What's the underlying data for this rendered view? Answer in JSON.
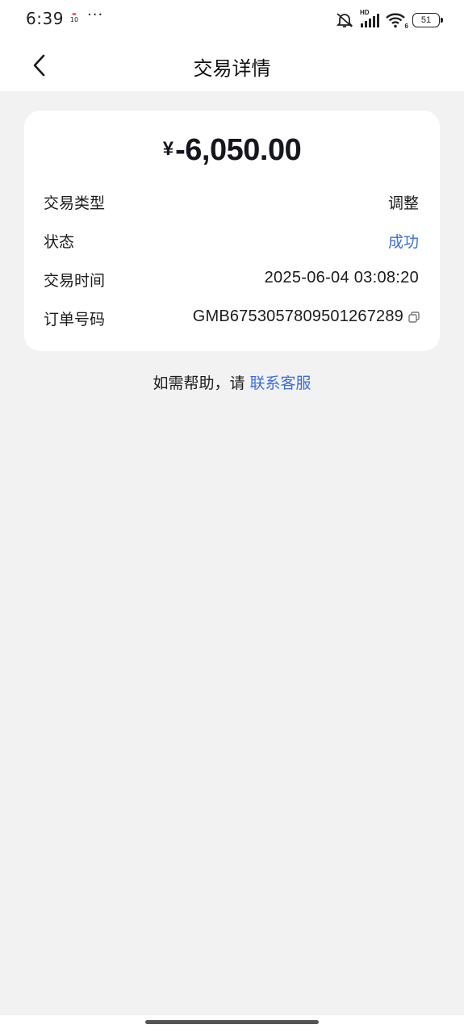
{
  "status_bar": {
    "time": "6:39",
    "calendar_day": "10",
    "more": "···",
    "network_label": "HD",
    "wifi_label": "6",
    "battery": "51"
  },
  "nav": {
    "back_icon": "chevron-left-icon",
    "title": "交易详情"
  },
  "transaction": {
    "currency_symbol": "¥",
    "amount": "-6,050.00",
    "rows": [
      {
        "label": "交易类型",
        "value": "调整"
      },
      {
        "label": "状态",
        "value": "成功"
      },
      {
        "label": "交易时间",
        "value": "2025-06-04 03:08:20"
      },
      {
        "label": "订单号码",
        "value": "GMB6753057809501267289"
      }
    ]
  },
  "help": {
    "prefix": "如需帮助，请 ",
    "link": "联系客服"
  },
  "colors": {
    "accent": "#3b6fd9",
    "page_bg": "#f2f2f2",
    "card_bg": "#ffffff"
  }
}
